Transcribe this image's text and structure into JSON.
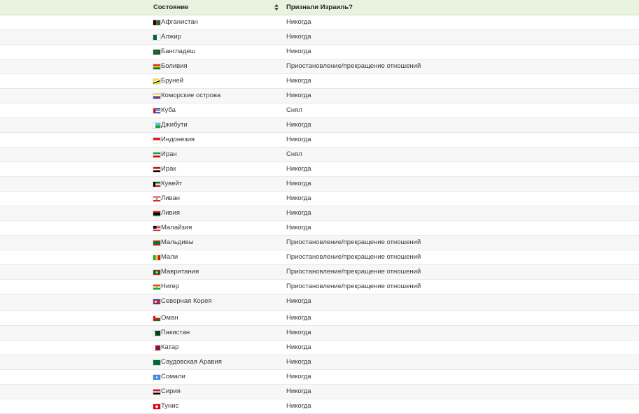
{
  "table": {
    "columns": [
      "Состояние",
      "Признали Израиль?"
    ],
    "rows": [
      {
        "country": "Афганистан",
        "status": "Никогда",
        "flag": "linear-gradient(90deg,#000 0 33%,#b32 33% 66%,#074 66%)"
      },
      {
        "country": "Алжир",
        "status": "Никогда",
        "flag": "linear-gradient(90deg,#063 0 50%,#fff 50%)"
      },
      {
        "country": "Бангладеш",
        "status": "Никогда",
        "flag": "radial-gradient(circle at 45% 50%,#d22 0 25%,#063 27%)"
      },
      {
        "country": "Боливия",
        "status": "Приостановление/прекращение отношений",
        "flag": "linear-gradient(#d32 0 33%,#f4d000 33% 66%,#073 66%)"
      },
      {
        "country": "Бруней",
        "status": "Никогда",
        "flag": "linear-gradient(160deg,#f7e017 0 35%,#fff 35% 50%,#000 50% 62%,#f7e017 62%)"
      },
      {
        "country": "Коморские острова",
        "status": "Никогда",
        "flag": "linear-gradient(#fd0 0 25%,#fff 25% 50%,#c22 50% 75%,#25b 75%)"
      },
      {
        "country": "Куба",
        "status": "Снял",
        "flag": "linear-gradient(90deg,#c22 0 35%,transparent 35%),linear-gradient(#02a 0 20%,#fff 20% 40%,#02a 40% 60%,#fff 60% 80%,#02a 80%)"
      },
      {
        "country": "Джибути",
        "status": "Никогда",
        "flag": "linear-gradient(90deg,#fff 0 30%,transparent 30%),linear-gradient(#6ab2e7 0 50%,#12ad2b 50%)"
      },
      {
        "country": "Индонезия",
        "status": "Никогда",
        "flag": "linear-gradient(#d22 0 50%,#fff 50%)"
      },
      {
        "country": "Иран",
        "status": "Снял",
        "flag": "linear-gradient(#239f40 0 33%,#fff 33% 66%,#da0000 66%)"
      },
      {
        "country": "Ирак",
        "status": "Никогда",
        "flag": "linear-gradient(#c11 0 33%,#fff 33% 66%,#000 66%)"
      },
      {
        "country": "Кувейт",
        "status": "Никогда",
        "flag": "linear-gradient(90deg,#000 0 30%,transparent 30%),linear-gradient(#073 0 33%,#fff 33% 66%,#c22 66%)"
      },
      {
        "country": "Ливан",
        "status": "Никогда",
        "flag": "radial-gradient(circle,#0a6 0 20%,transparent 22%),linear-gradient(#e22 0 25%,#fff 25% 75%,#e22 75%)"
      },
      {
        "country": "Ливия",
        "status": "Никогда",
        "flag": "linear-gradient(#e22 0 25%,#000 25% 75%,#293 75%)"
      },
      {
        "country": "Малайзия",
        "status": "Никогда",
        "flag": "linear-gradient(90deg,#013 0 45%,transparent 45%) 0 0/100% 55% no-repeat,repeating-linear-gradient(#c22 0 1px,#fff 1px 2px)"
      },
      {
        "country": "Мальдивы",
        "status": "Приостановление/прекращение отношений",
        "flag": "linear-gradient(#d21 0 20%,#073 20% 80%,#d21 80%)"
      },
      {
        "country": "Мали",
        "status": "Приостановление/прекращение отношений",
        "flag": "linear-gradient(90deg,#14b53a 0 33%,#fcd116 33% 66%,#ce1126 66%)"
      },
      {
        "country": "Мавритания",
        "status": "Приостановление/прекращение отношений",
        "flag": "radial-gradient(circle,#fd0 0 25%,transparent 27%),linear-gradient(#c22 0 15%,#063 15% 85%,#c22 85%)"
      },
      {
        "country": "Нигер",
        "status": "Приостановление/прекращение отношений",
        "flag": "radial-gradient(circle,#e05206 0 12%,transparent 14%),linear-gradient(#e05206 0 33%,#fff 33% 66%,#0db02b 66%)"
      },
      {
        "country": "Северная Корея",
        "status": "Никогда",
        "flag": "radial-gradient(circle at 35% 50%,#fff 0 18%,transparent 20%),linear-gradient(#024fa2 0 18%,#fff 18% 24%,#ed1c27 24% 76%,#fff 76% 82%,#024fa2 82%)"
      },
      {
        "country": "Оман",
        "status": "Никогда",
        "flag": "linear-gradient(90deg,#db161b 0 30%,transparent 30%),linear-gradient(#fff 0 33%,#db161b 33% 66%,#008000 66%)"
      },
      {
        "country": "Пакистан",
        "status": "Никогда",
        "flag": "linear-gradient(90deg,#fff 0 25%,#01411c 25%)"
      },
      {
        "country": "Катар",
        "status": "Никогда",
        "flag": "linear-gradient(90deg,#fff 0 30%,#8a1538 30%)"
      },
      {
        "country": "Саудовская Аравия",
        "status": "Никогда",
        "flag": "linear-gradient(#006c35,#006c35)"
      },
      {
        "country": "Сомали",
        "status": "Никогда",
        "flag": "radial-gradient(circle,#fff 0 20%,#4189dd 22%)"
      },
      {
        "country": "Сирия",
        "status": "Никогда",
        "flag": "linear-gradient(#ce1126 0 33%,#fff 33% 66%,#000 66%)"
      },
      {
        "country": "Тунис",
        "status": "Никогда",
        "flag": "radial-gradient(circle,#fff 0 30%,#e70013 32%)"
      }
    ]
  }
}
